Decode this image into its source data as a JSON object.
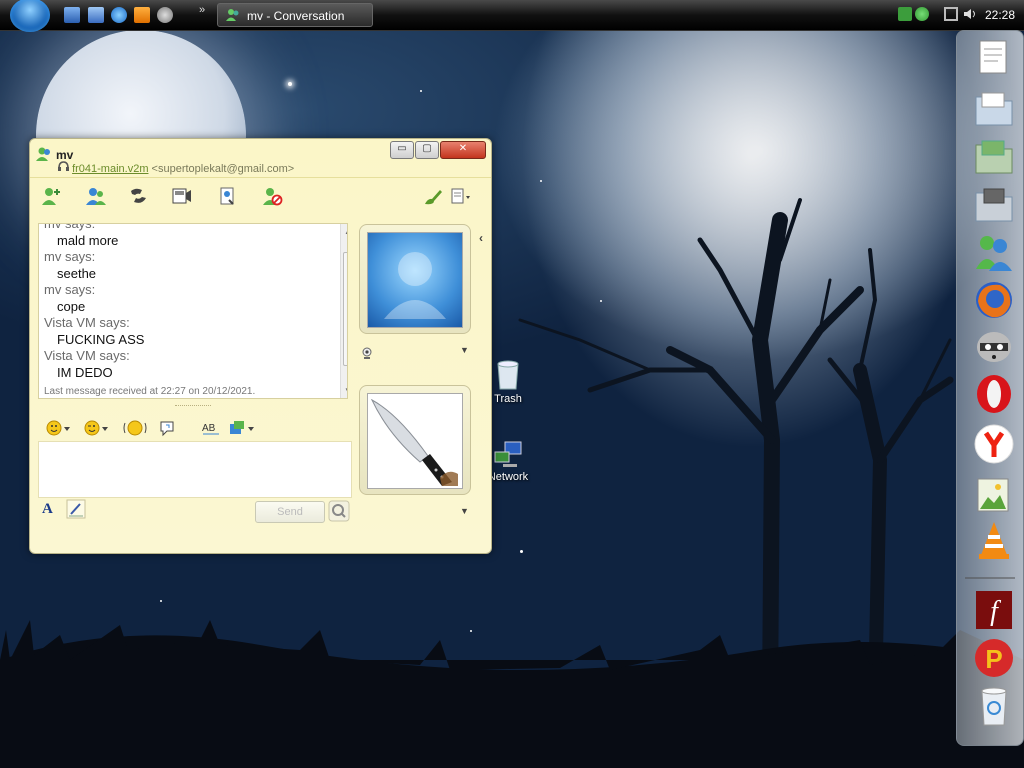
{
  "taskbar": {
    "task_label": "mv - Conversation",
    "clock": "22:28"
  },
  "desktop_icons": [
    {
      "label": "Trash"
    },
    {
      "label": "Network"
    }
  ],
  "conversation": {
    "contact_name": "mv",
    "account": "fr041-main.v2m",
    "email": "<supertoplekalt@gmail.com>",
    "messages": [
      {
        "sender": "mv says:",
        "text": "mald more"
      },
      {
        "sender": "mv says:",
        "text": "seethe"
      },
      {
        "sender": "mv says:",
        "text": "cope"
      },
      {
        "sender": "Vista VM says:",
        "text": "FUCKING ASS"
      },
      {
        "sender": "Vista VM says:",
        "text": "IM DEDO"
      }
    ],
    "last_message": "Last message received at 22:27 on 20/12/2021.",
    "send_label": "Send"
  },
  "dock": {
    "icons": [
      "documents-icon",
      "folder-icon",
      "folder-icon",
      "folder-icon",
      "contacts-icon",
      "firefox-icon",
      "raccoon-icon",
      "opera-icon",
      "yandex-icon",
      "image-viewer-icon",
      "vlc-icon",
      "flash-icon",
      "p-app-icon",
      "recycle-bin-icon"
    ]
  },
  "colors": {
    "window_bg": "#fbf6c8",
    "accent_green": "#6b8c2a"
  }
}
